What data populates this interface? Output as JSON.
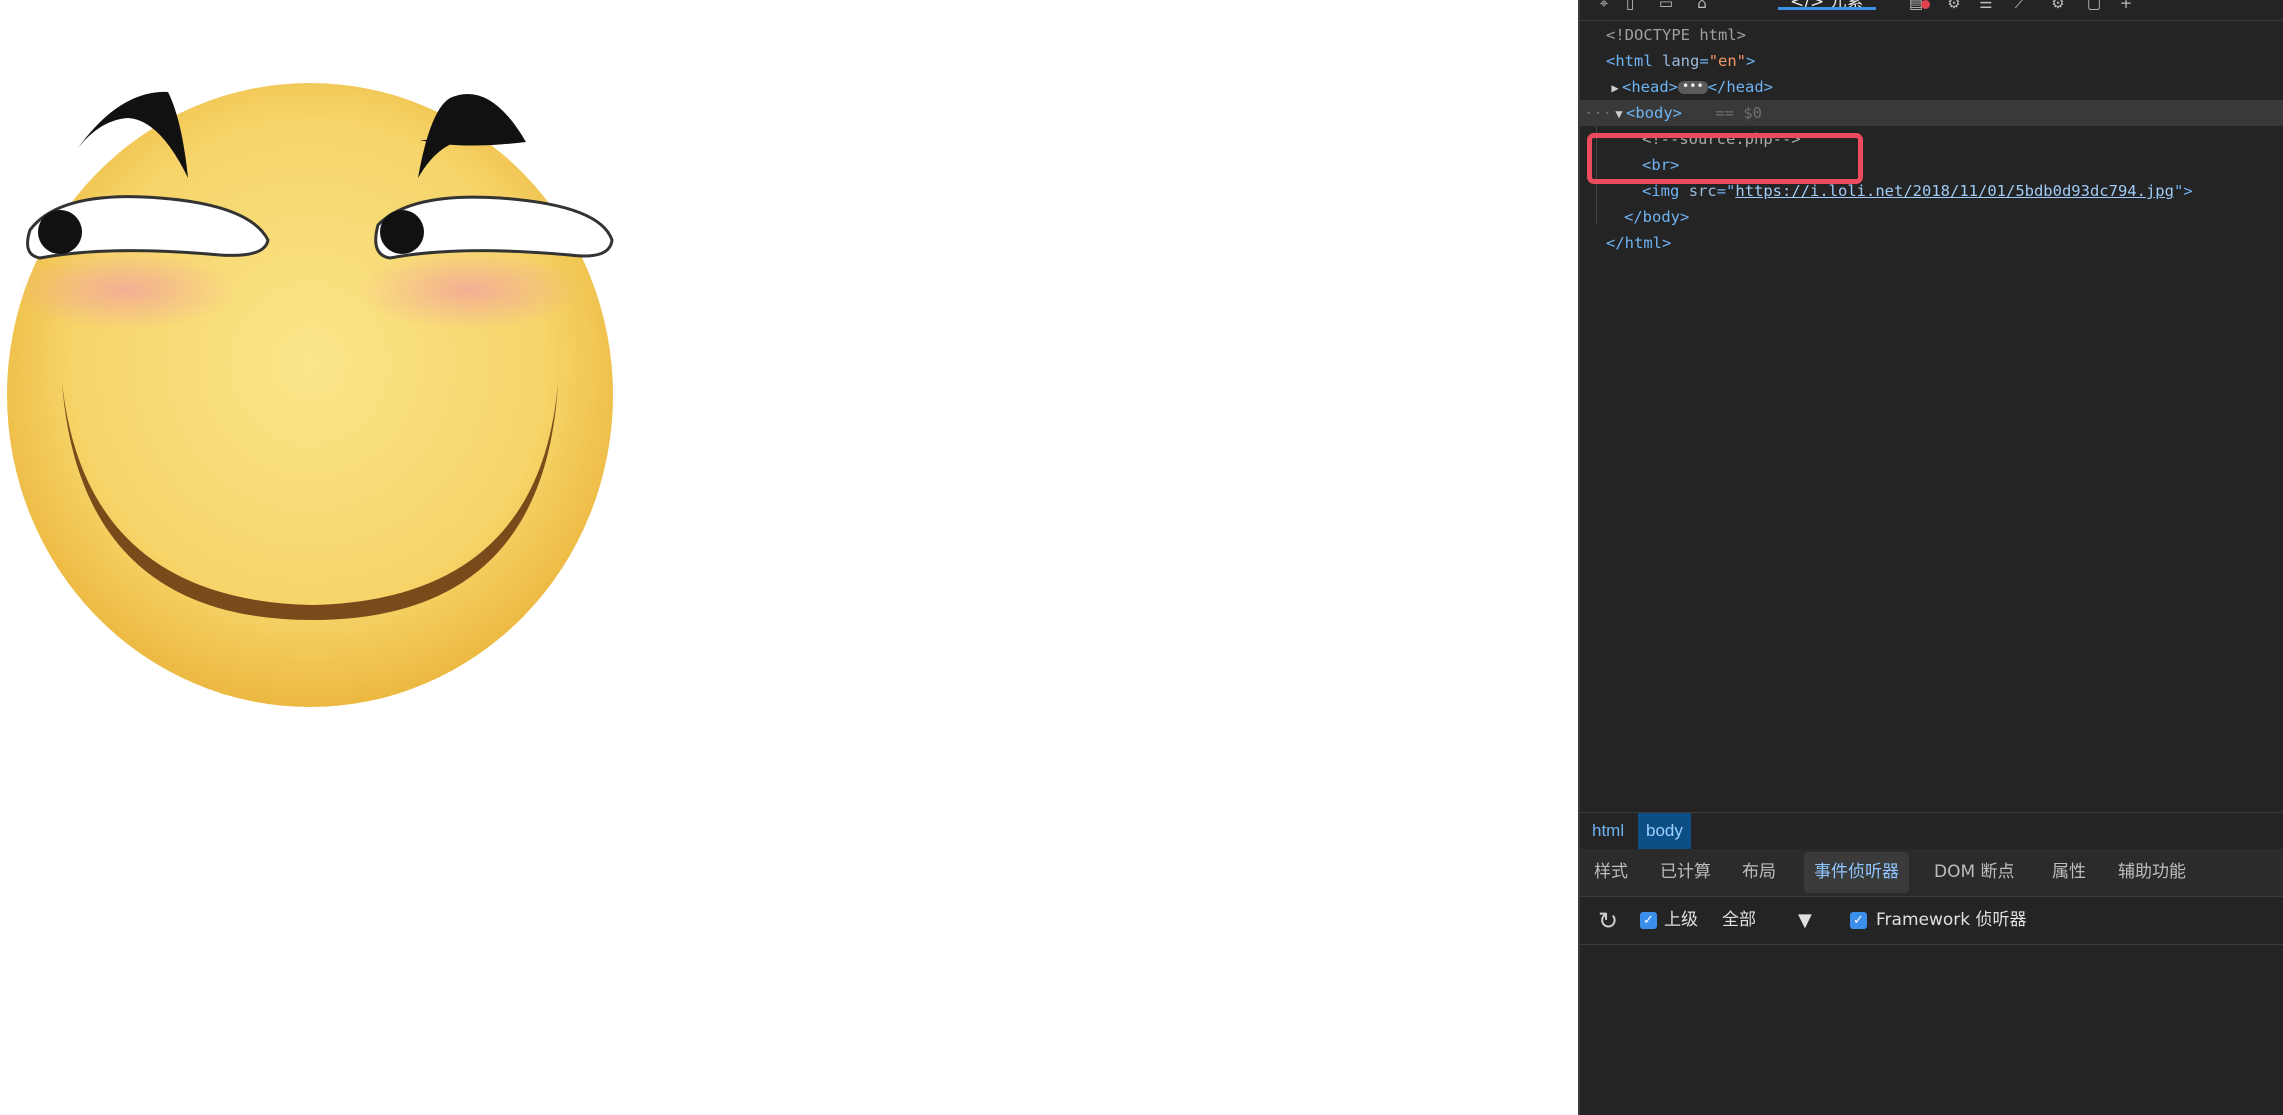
{
  "devtools": {
    "active_tab_label": "</> 元素",
    "toolbar_icons": [
      "inspect-icon",
      "device-icon",
      "dock-icon",
      "welcome-icon",
      "console-icon",
      "sources-icon",
      "network-icon",
      "performance-icon",
      "memory-icon",
      "application-icon",
      "more-icon"
    ],
    "dom": {
      "doctype": "<!DOCTYPE html>",
      "html_open_tag": "html",
      "html_attr_name": "lang",
      "html_attr_value": "\"en\"",
      "head_open": "<head>",
      "head_close": "</head>",
      "head_ellipsis": "•••",
      "body_open": "<body>",
      "body_marker": "== $0",
      "comment": "<!--source.php-->",
      "br": "<br>",
      "img_tag": "img",
      "img_attr_name": "src",
      "img_src": "https://i.loli.net/2018/11/01/5bdb0d93dc794.jpg",
      "body_close": "</body>",
      "html_close": "</html>"
    },
    "breadcrumb": [
      "html",
      "body"
    ],
    "panel_tabs": [
      "样式",
      "已计算",
      "布局",
      "事件侦听器",
      "DOM 断点",
      "属性",
      "辅助功能"
    ],
    "active_panel_tab": "事件侦听器",
    "listeners": {
      "ancestors_label": "上级",
      "ancestors_checked": true,
      "filter_value": "全部",
      "framework_label": "Framework 侦听器",
      "framework_checked": true
    }
  }
}
